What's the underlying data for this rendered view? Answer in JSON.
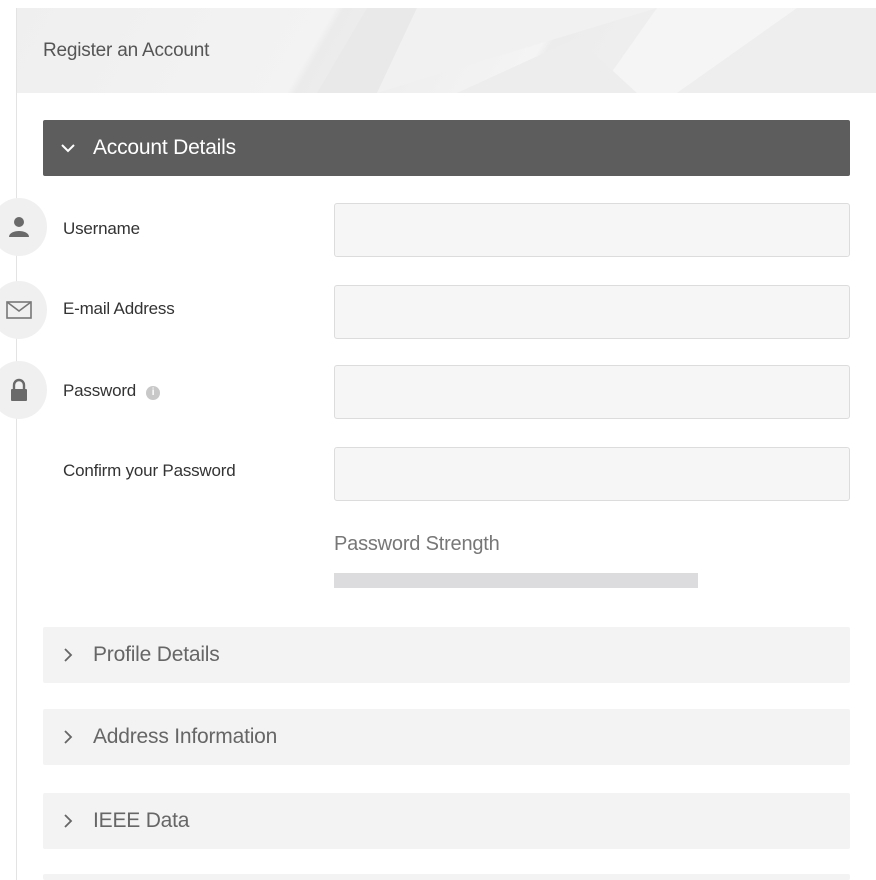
{
  "header": {
    "title": "Register an Account"
  },
  "sections": [
    {
      "label": "Account Details",
      "expanded": true,
      "icon": "chevron-down-icon"
    },
    {
      "label": "Profile Details",
      "expanded": false,
      "icon": "chevron-right-icon"
    },
    {
      "label": "Address Information",
      "expanded": false,
      "icon": "chevron-right-icon"
    },
    {
      "label": "IEEE Data",
      "expanded": false,
      "icon": "chevron-right-icon"
    }
  ],
  "account": {
    "username": {
      "label": "Username",
      "value": "",
      "placeholder": "",
      "icon": "user-icon"
    },
    "email": {
      "label": "E-mail Address",
      "value": "",
      "placeholder": "",
      "icon": "envelope-icon"
    },
    "password": {
      "label": "Password",
      "value": "",
      "placeholder": "",
      "icon": "lock-icon",
      "info_icon": "info-icon"
    },
    "confirm_password": {
      "label": "Confirm your Password",
      "value": "",
      "placeholder": ""
    },
    "strength": {
      "label": "Password Strength",
      "level": 0
    }
  },
  "colors": {
    "active_section_bg": "#5d5d5d",
    "collapsed_section_bg": "#f3f3f3",
    "input_bg": "#f6f6f6",
    "strength_track": "#dcdcdf"
  }
}
